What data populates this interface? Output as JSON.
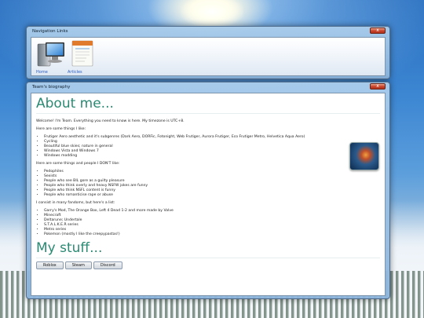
{
  "nav_window": {
    "title": "Navigation Links",
    "close_glyph": "x",
    "items": [
      {
        "label": "Home",
        "icon": "computer-icon"
      },
      {
        "label": "Articles",
        "icon": "calendar-icon"
      }
    ]
  },
  "bio_window": {
    "title": "Team's biography",
    "close_glyph": "x",
    "heading_about": "About me...",
    "intro": "Welcome! I'm Team. Everything you need to know is here. My timezone is UTC+8.",
    "likes_heading": "Here are some things I like:",
    "likes": [
      "Frutiger Aero aesthetic and it's subgenres (Dark Aero, DORFic, Fotonight, Web Frutiger, Aurora Frutiger, Eco Frutiger Metro, Helvetica Aqua Aero)",
      "Cycling",
      "Beautiful blue skies; nature in general",
      "Windows Vista and Windows 7",
      "Windows modding"
    ],
    "dislikes_heading": "Here are some things and people I DON'T like:",
    "dislikes": [
      "Pedophiles",
      "Sexists",
      "People who see BIL gore as a guilty pleasure",
      "People who think overly and heavy NSFW jokes are funny",
      "People who think NSFL content is funny",
      "People who romanticise rape or abuse"
    ],
    "fandoms_heading": "I consist in many fandoms, but here's a list:",
    "fandoms": [
      "Garry's Mod, The Orange Box, Left 4 Dead 1-2 and more made by Valve",
      "Minecraft",
      "Deltarune; Undertale",
      "S.T.A.L.K.E.R series",
      "Metro series",
      "Pokemon (mostly I like the creepypastas!)"
    ],
    "heading_stuff": "My stuff...",
    "buttons": [
      "Roblox",
      "Steam",
      "Discord"
    ]
  },
  "colors": {
    "heading": "#2a8a72",
    "link": "#2a5bbf",
    "close": "#c8432a"
  }
}
